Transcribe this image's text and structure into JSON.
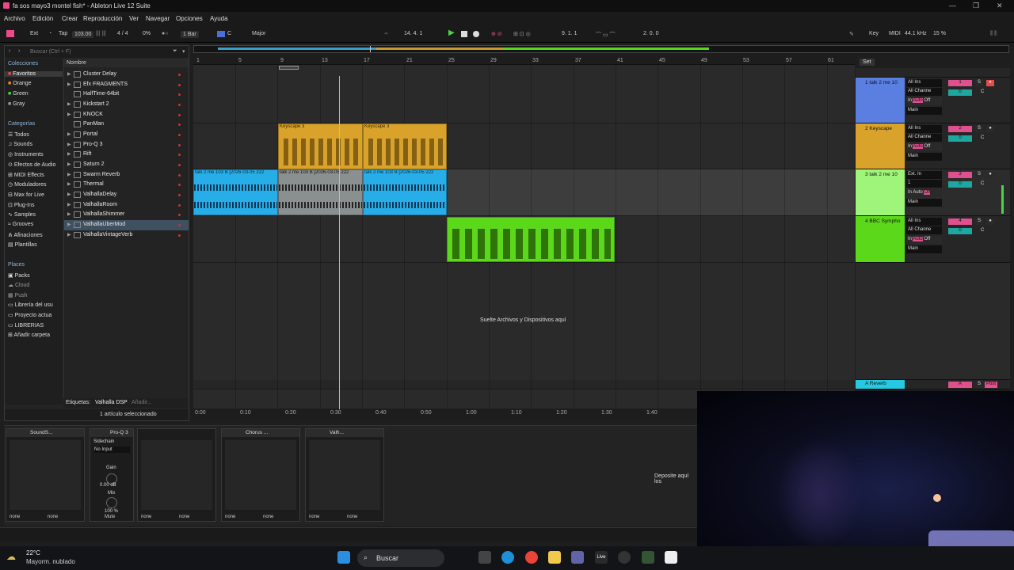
{
  "window": {
    "title": "fa sos mayo3 montel fish* - Ableton Live 12 Suite"
  },
  "menu": [
    "Archivo",
    "Edición",
    "Crear",
    "Reproducción",
    "Ver",
    "Navegar",
    "Opciones",
    "Ayuda"
  ],
  "transport": {
    "ext": "Ext",
    "tap": "Tap",
    "tempo": "103.00",
    "signature": "4 / 4",
    "cpu_pct": "0%",
    "quant": "1 Bar",
    "key": "C",
    "scale": "Major",
    "position": "14.   4.   1",
    "loop_start": "9.   1.   1",
    "loop_len": "2.   0.   0",
    "key_btn": "Key",
    "midi_btn": "MIDI",
    "sample_rate": "44.1 kHz",
    "cpu_load": "15 %"
  },
  "browser": {
    "search_placeholder": "Buscar (Ctrl + F)",
    "column_header": "Nombre",
    "collections_title": "Colecciones",
    "collections": [
      "Favoritos",
      "Orange",
      "Green",
      "Gray"
    ],
    "categories_title": "Categorías",
    "categories": [
      "Todos",
      "Sounds",
      "Instruments",
      "Efectos de Audio",
      "MIDI Effects",
      "Moduladores",
      "Max for Live",
      "Plug-Ins",
      "Samples",
      "Grooves",
      "Afinaciones",
      "Plantillas"
    ],
    "places_title": "Places",
    "places": [
      "Packs",
      "Cloud",
      "Push",
      "Librería del usu",
      "Proyecto actua",
      "LIBRERIAS",
      "Añadir carpeta"
    ],
    "items": [
      "Cluster Delay",
      "Efx FRAGMENTS",
      "HalfTime-64bit",
      "Kickstart 2",
      "KNOCK",
      "PanMan",
      "Portal",
      "Pro-Q 3",
      "Rift",
      "Saturn 2",
      "Swarm Reverb",
      "Thermal",
      "ValhallaDelay",
      "ValhallaRoom",
      "ValhallaShimmer",
      "ValhallaUberMod",
      "ValhallaVintageVerb"
    ],
    "selected_item": "ValhallaUberMod",
    "tags_label": "Etiquetas:",
    "tag_value": "Valhalla DSP",
    "tag_add": "Añadir...",
    "status": "1 artículo seleccionado"
  },
  "ruler": [
    "1",
    "5",
    "9",
    "13",
    "17",
    "21",
    "25",
    "29",
    "33",
    "37",
    "41",
    "45",
    "49",
    "53",
    "57",
    "61"
  ],
  "timeline": [
    "0:00",
    "0:10",
    "0:20",
    "0:30",
    "0:40",
    "0:50",
    "1:00",
    "1:10",
    "1:20",
    "1:30",
    "1:40"
  ],
  "clips": {
    "keyscape_a": "Keyscape 3",
    "keyscape_b": "Keyscape 3",
    "audio_a": "talk 2 me 103 B [2026-03-05 222",
    "audio_b": "talk 2 me 103 B [2026-03-05 222",
    "audio_c": "talk 2 me 103 B [2026-03-05 222"
  },
  "drop_message": "Suelte Archivos y Dispositivos aquí",
  "tracks": [
    {
      "name": "1 talk 2 me 10",
      "input": "All Ins",
      "channel": "All Channe",
      "out": "Main",
      "num": "1",
      "vol": "0",
      "pan": "C",
      "color": "#5a7fe0"
    },
    {
      "name": "2 Keyscape",
      "input": "All Ins",
      "channel": "All Channe",
      "out": "Main",
      "num": "2",
      "vol": "0",
      "pan": "C",
      "color": "#d9a32b"
    },
    {
      "name": "3 talk 2 me 10",
      "input": "Ext. In",
      "channel": "1",
      "out": "Main",
      "num": "3",
      "vol": "0",
      "pan": "C",
      "color": "#9ff57a"
    },
    {
      "name": "4 BBC Sympho",
      "input": "All Ins",
      "channel": "All Channe",
      "out": "Main",
      "num": "4",
      "vol": "0",
      "pan": "C",
      "color": "#5cd81b"
    }
  ],
  "monitor": {
    "in": "In",
    "auto": "Auto",
    "off": "Off",
    "vol_off": "-oo"
  },
  "return_track": {
    "name": "A Reverb",
    "num": "A",
    "post": "Post"
  },
  "devices": [
    {
      "name": "SoundS..."
    },
    {
      "name": "Pro-Q 3",
      "sidechain": "Sidechain",
      "sc_input": "No Input",
      "gain_label": "Gain",
      "gain_value": "0.00 dB",
      "mix_label": "Mix",
      "mix_value": "100 %",
      "mute": "Mute"
    },
    {
      "name": "Chorus ..."
    },
    {
      "name": "Valh..."
    }
  ],
  "device_none": "none",
  "device_drop": "Deposite aquí los",
  "weather": {
    "temp": "22°C",
    "desc": "Mayorm. nublado"
  },
  "taskbar_search": "Buscar",
  "colors": {
    "keyscape": "#d9a32b",
    "audio": "#27aee8",
    "audio_sel": "#8a8f8f",
    "bbc": "#5cd81b",
    "return": "#27c9e0"
  }
}
